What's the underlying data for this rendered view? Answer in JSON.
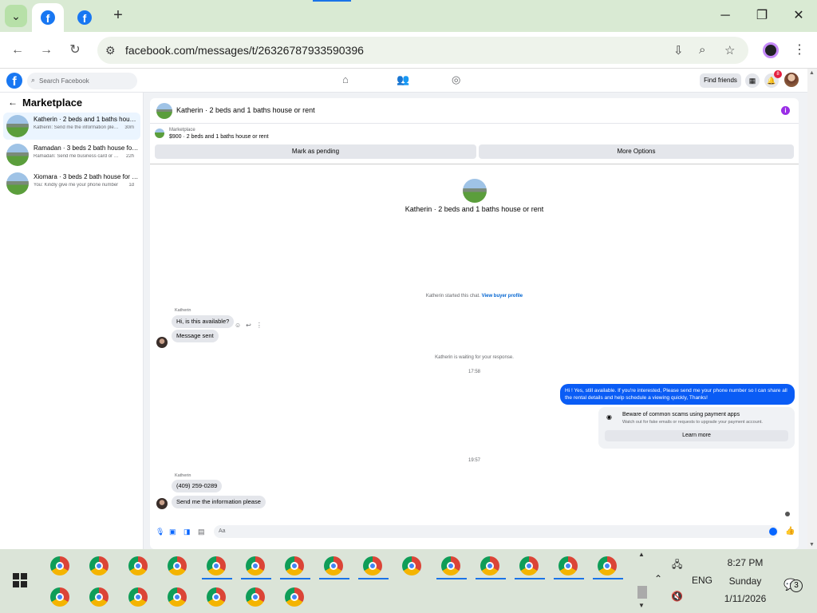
{
  "browser": {
    "address": "facebook.com/messages/t/26326787933590396",
    "new_tab_glyph": "+",
    "window_controls": {
      "minimize": "─",
      "maximize": "❐",
      "close": "✕"
    }
  },
  "facebook": {
    "search_placeholder": "Search Facebook",
    "find_friends": "Find friends",
    "notification_count": "8"
  },
  "sidebar": {
    "title": "Marketplace",
    "conversations": [
      {
        "title": "Katherin · 2 beds and 1 baths house or rent",
        "preview": "Katherin: Send me the information please",
        "time": "30m"
      },
      {
        "title": "Ramadan · 3 beds 2 bath house for rent",
        "preview": "Ramadan: Send me business card or info",
        "time": "22h"
      },
      {
        "title": "Xiomara · 3 beds 2 bath house for rent",
        "preview": "You: Kindly give me your phone number",
        "time": "1d"
      }
    ]
  },
  "chat": {
    "header_title": "Katherin · 2 beds and 1 baths house or rent",
    "listing_source": "Marketplace",
    "listing_price": "$900 · 2 beds and 1 baths house or rent",
    "mark_pending": "Mark as pending",
    "more_options": "More Options",
    "center_title": "Katherin · 2 beds and 1 baths house or rent",
    "started_text": "Katherin started this chat.",
    "view_profile": "View buyer profile",
    "sender_name": "Katherin",
    "msg1": "Hi, is this available?",
    "msg2": "Message sent",
    "waiting_text": "Katherin is waiting for your response.",
    "time1": "17:58",
    "outgoing": "Hi ! Yes, still available. If you're interested, Please send me your phone number so I can share all the rental details and help schedule a viewing quickly, Thanks!",
    "scam_title": "Beware of common scams using payment apps",
    "scam_sub": "Watch out for fake emails or requests to upgrade your payment account.",
    "learn_more": "Learn more",
    "time2": "19:57",
    "msg3": "(409) 259-0289",
    "msg4": "Send me the information please",
    "composer_placeholder": "Aa"
  },
  "taskbar": {
    "language": "ENG",
    "time": "8:27 PM",
    "day": "Sunday",
    "date": "1/11/2026",
    "notification_count": "3"
  },
  "colors": {
    "brand": "#1877f2",
    "outgoing_bubble": "#0a5cf5",
    "tab_strip": "#d9ead3",
    "taskbar": "#dbe4d8"
  }
}
